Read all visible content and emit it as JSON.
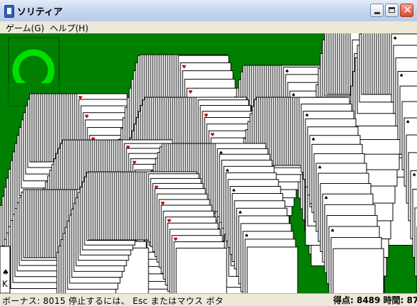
{
  "window": {
    "title": "ソリティア",
    "controls": {
      "minimize": "minimize",
      "maximize": "maximize",
      "close": "✕"
    }
  },
  "menubar": {
    "items": [
      {
        "label": "ゲーム(G)"
      },
      {
        "label": "ヘルプ(H)"
      }
    ]
  },
  "game": {
    "felt_color": "#008000",
    "stock_indicator": "recycle-ring",
    "stock_ring_color": "#00e000",
    "card_back_color": "#ffffff",
    "card_edge_color": "#000000",
    "red_suit": "hearts",
    "black_suit": "spades",
    "bottom_left_card": "K",
    "bottom_left_suit": "♠"
  },
  "statusbar": {
    "bonus_text": "ボーナス: 8015  停止するには、 Esc またはマウス ボタ",
    "score_text": "得点: 8489 時間: 87"
  }
}
